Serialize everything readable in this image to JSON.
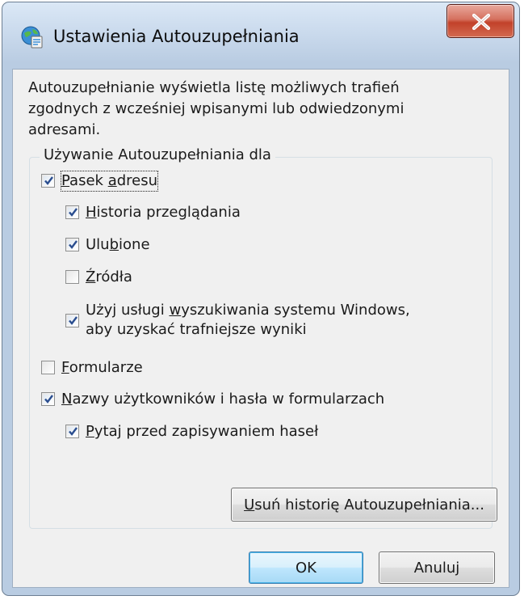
{
  "window": {
    "title": "Ustawienia Autouzupełniania",
    "close_label": "X"
  },
  "description": {
    "line1": "Autouzupełnianie wyświetla listę możliwych trafień",
    "line2": "zgodnych z wcześniej wpisanymi lub odwiedzonymi",
    "line3": "adresami."
  },
  "group": {
    "legend": "Używanie Autouzupełniania dla"
  },
  "options": {
    "address_bar": {
      "pre": "",
      "accel": "P",
      "post": "asek ",
      "accel2": "a",
      "post2": "dresu",
      "checked": true
    },
    "history": {
      "accel": "H",
      "rest": "istoria przeglądania",
      "checked": true
    },
    "favorites": {
      "pre": "Ulu",
      "accel": "b",
      "rest": "ione",
      "checked": true
    },
    "feeds": {
      "accel": "Ź",
      "rest": "ródła",
      "checked": false
    },
    "windows_search": {
      "pre": "Użyj usługi ",
      "accel": "w",
      "rest": "yszukiwania systemu Windows,",
      "line2": "aby uzyskać trafniejsze wyniki",
      "checked": true
    },
    "forms": {
      "accel": "F",
      "rest": "ormularze",
      "checked": false
    },
    "usernames": {
      "accel": "N",
      "rest": "azwy użytkowników i hasła w formularzach",
      "checked": true
    },
    "ask_passwords": {
      "accel": "P",
      "rest": "ytaj przed zapisywaniem haseł",
      "checked": true
    }
  },
  "buttons": {
    "delete_history": {
      "accel": "U",
      "rest": "suń historię Autouzupełniania..."
    },
    "ok": "OK",
    "cancel": "Anuluj"
  }
}
